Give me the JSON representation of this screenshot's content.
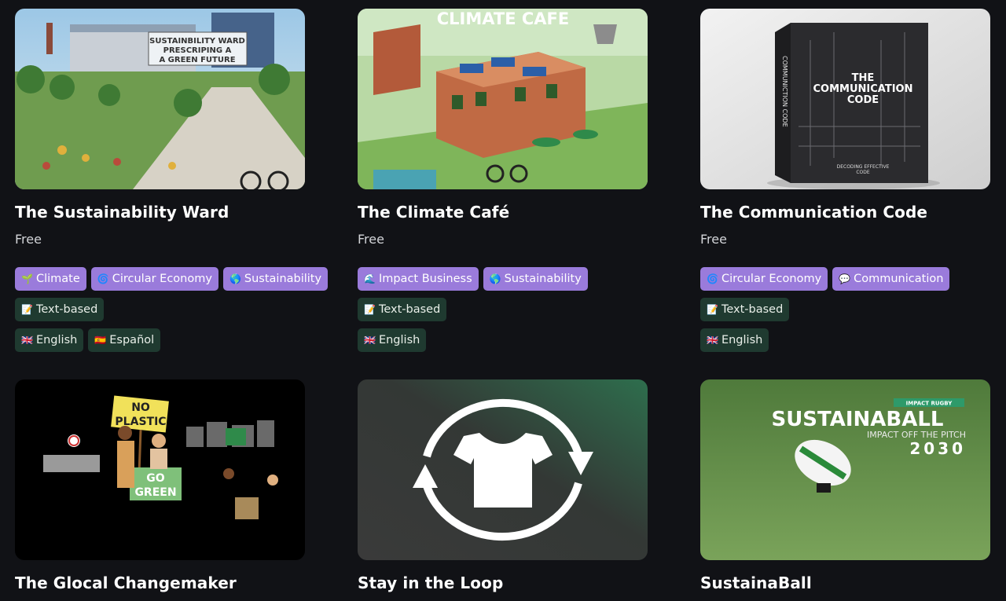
{
  "cards": [
    {
      "title": "The Sustainability Ward",
      "price": "Free",
      "image_text": [
        "SUSTAINBILITY WARD",
        "PRESCRIPING A",
        "A GREEN FUTURE"
      ],
      "tags_topics": [
        {
          "icon": "🌱",
          "label": "Climate"
        },
        {
          "icon": "🌀",
          "label": "Circular Economy"
        },
        {
          "icon": "🌎",
          "label": "Sustainability"
        }
      ],
      "tags_format": [
        {
          "icon": "📝",
          "label": "Text-based"
        }
      ],
      "tags_language": [
        {
          "icon": "🇬🇧",
          "label": "English"
        },
        {
          "icon": "🇪🇸",
          "label": "Español"
        }
      ]
    },
    {
      "title": "The Climate Café",
      "price": "Free",
      "image_text": [
        "CLIMATE CAFE"
      ],
      "tags_topics": [
        {
          "icon": "🌊",
          "label": "Impact Business"
        },
        {
          "icon": "🌎",
          "label": "Sustainability"
        }
      ],
      "tags_format": [
        {
          "icon": "📝",
          "label": "Text-based"
        }
      ],
      "tags_language": [
        {
          "icon": "🇬🇧",
          "label": "English"
        }
      ]
    },
    {
      "title": "The Communication Code",
      "price": "Free",
      "image_text": [
        "THE",
        "COMMUNICATION",
        "CODE",
        "DECODING EFFECTIVE",
        "CODE",
        "COMMUNICTION CODE"
      ],
      "tags_topics": [
        {
          "icon": "🌀",
          "label": "Circular Economy"
        },
        {
          "icon": "💬",
          "label": "Communication"
        }
      ],
      "tags_format": [
        {
          "icon": "📝",
          "label": "Text-based"
        }
      ],
      "tags_language": [
        {
          "icon": "🇬🇧",
          "label": "English"
        }
      ]
    },
    {
      "title": "The Glocal Changemaker",
      "image_text": [
        "NO",
        "PLASTIC",
        "GO",
        "GREEN"
      ]
    },
    {
      "title": "Stay in the Loop"
    },
    {
      "title": "SustainaBall",
      "image_text": [
        "IMPACT RUGBY",
        "SUSTAINABALL",
        "IMPACT OFF THE PITCH",
        "2030"
      ]
    }
  ],
  "colors": {
    "background": "#111216",
    "tag_purple": "#9a7bdb",
    "tag_green": "#1f3a30"
  }
}
